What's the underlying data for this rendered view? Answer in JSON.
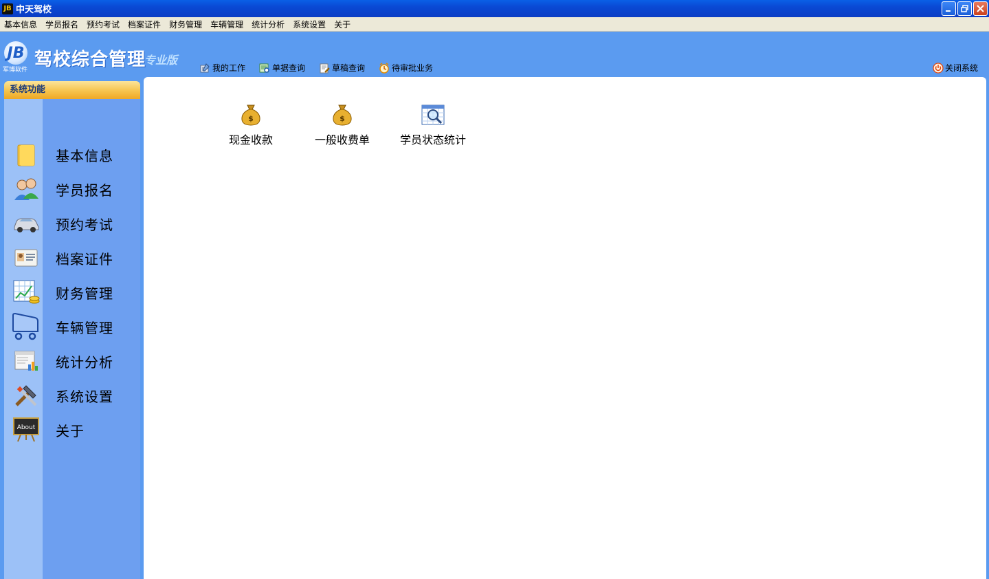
{
  "window": {
    "title": "中天驾校",
    "icon_text": "JB"
  },
  "menu": [
    "基本信息",
    "学员报名",
    "预约考试",
    "档案证件",
    "财务管理",
    "车辆管理",
    "统计分析",
    "系统设置",
    "关于"
  ],
  "header": {
    "logo_text": "JB",
    "logo_sub": "军博软件",
    "title": "驾校综合管理",
    "edition": "专业版"
  },
  "toolbar": [
    {
      "label": "我的工作",
      "icon": "work-icon"
    },
    {
      "label": "单据查询",
      "icon": "document-search-icon"
    },
    {
      "label": "草稿查询",
      "icon": "draft-icon"
    },
    {
      "label": "待审批业务",
      "icon": "approval-icon"
    }
  ],
  "close_system": "关闭系统",
  "sidebar": {
    "title": "系统功能",
    "items": [
      {
        "label": "基本信息",
        "icon": "folder-icon"
      },
      {
        "label": "学员报名",
        "icon": "users-icon"
      },
      {
        "label": "预约考试",
        "icon": "car-icon"
      },
      {
        "label": "档案证件",
        "icon": "id-card-icon"
      },
      {
        "label": "财务管理",
        "icon": "finance-chart-icon"
      },
      {
        "label": "车辆管理",
        "icon": "cart-icon"
      },
      {
        "label": "统计分析",
        "icon": "stats-icon"
      },
      {
        "label": "系统设置",
        "icon": "tools-icon"
      },
      {
        "label": "关于",
        "icon": "about-board-icon",
        "icon_text": "About"
      }
    ]
  },
  "shortcuts": [
    {
      "label": "现金收款",
      "icon": "money-bag-icon",
      "icon_text": "$"
    },
    {
      "label": "一般收费单",
      "icon": "money-bag-icon",
      "icon_text": "$"
    },
    {
      "label": "学员状态统计",
      "icon": "magnifier-table-icon"
    }
  ],
  "colors": {
    "accent": "#5b9bf0",
    "sidebar": "#6d9ff0",
    "sidebar_head": "#f6c34c",
    "titlebar": "#0a49d4"
  }
}
